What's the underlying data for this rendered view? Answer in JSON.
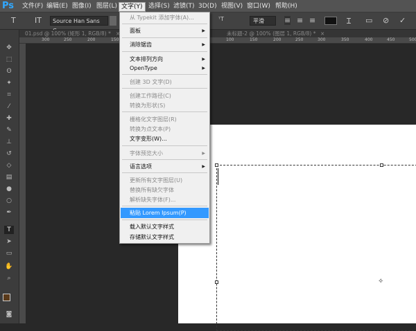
{
  "app": {
    "logo": "Ps"
  },
  "menubar": [
    "文件(F)",
    "编辑(E)",
    "图像(I)",
    "图层(L)",
    "文字(Y)",
    "选择(S)",
    "滤镜(T)",
    "3D(D)",
    "视图(V)",
    "窗口(W)",
    "帮助(H)"
  ],
  "options": {
    "font_family": "Source Han Sans C...",
    "antialias": "平滑",
    "text_color": "#111111"
  },
  "tabs": [
    "01.psd @ 100% (矩形 1, RGB/8) *",
    "未标题-2 @ 100% (图层 1, RGB/8) *"
  ],
  "ruler": [
    "300",
    "250",
    "200",
    "150",
    "100",
    "150",
    "200",
    "250",
    "300",
    "350",
    "400",
    "450",
    "500"
  ],
  "dropdown": {
    "items": [
      {
        "label": "从 Typekit 添加字体(A)...",
        "enabled": false
      },
      {
        "label": "面板",
        "enabled": true,
        "submenu": true
      },
      {
        "label": "消除锯齿",
        "enabled": true,
        "submenu": true
      },
      {
        "label": "文本排列方向",
        "enabled": true,
        "submenu": true
      },
      {
        "label": "OpenType",
        "enabled": true,
        "submenu": true
      },
      {
        "label": "创建 3D 文字(D)",
        "enabled": false
      },
      {
        "label": "创建工作路径(C)",
        "enabled": false
      },
      {
        "label": "转换为形状(S)",
        "enabled": false
      },
      {
        "label": "栅格化文字图层(R)",
        "enabled": false
      },
      {
        "label": "转换为点文本(P)",
        "enabled": false
      },
      {
        "label": "文字变形(W)...",
        "enabled": true
      },
      {
        "label": "字体预览大小",
        "enabled": false,
        "submenu": true
      },
      {
        "label": "语言选项",
        "enabled": true,
        "submenu": true
      },
      {
        "label": "更新所有文字图层(U)",
        "enabled": false
      },
      {
        "label": "替换所有缺欠字体",
        "enabled": false
      },
      {
        "label": "解析缺失字体(F)...",
        "enabled": false
      },
      {
        "label": "粘贴 Lorem Ipsum(P)",
        "enabled": true,
        "highlighted": true
      },
      {
        "label": "载入默认文字样式",
        "enabled": true
      },
      {
        "label": "存储默认文字样式",
        "enabled": true
      }
    ]
  },
  "colors": {
    "accent": "#3399ff",
    "foreground": "#5a3a1a",
    "background": "#ffffff"
  }
}
